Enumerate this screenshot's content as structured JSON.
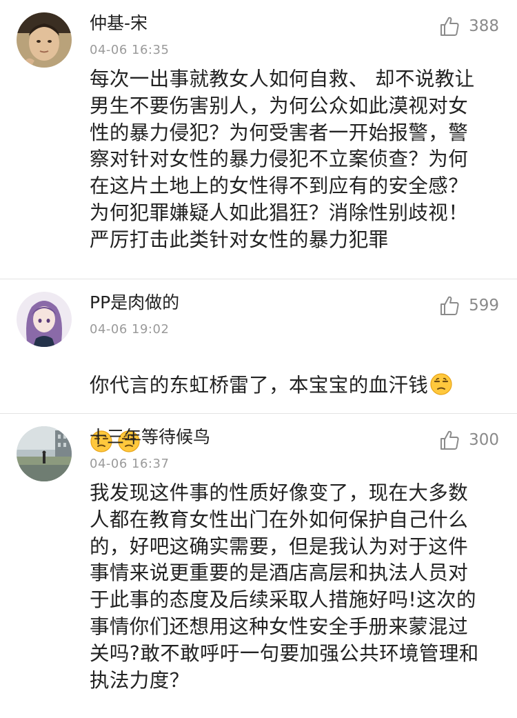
{
  "comments": [
    {
      "username": "仲基-宋",
      "timestamp": "04-06 16:35",
      "likes": "388",
      "avatar_icon": "avatar-photo-man",
      "content": "每次一出事就教女人如何自救、 却不说教让\n男生不要伤害别人，为何公众如此漠视对女\n性的暴力侵犯？为何受害者一开始报警，警\n察对针对女性的暴力侵犯不立案侦查？为何\n在这片土地上的女性得不到应有的安全感？\n为何犯罪嫌疑人如此猖狂？消除性别歧视！\n严厉打击此类针对女性的暴力犯罪"
    },
    {
      "username": "PP是肉做的",
      "timestamp": "04-06 19:02",
      "likes": "599",
      "avatar_icon": "avatar-anime-girl",
      "content": "你代言的东虹桥雷了，本宝宝的血汗钱",
      "emojis": [
        "unamused-face-emoji",
        "unamused-face-emoji",
        "unamused-face-emoji"
      ]
    },
    {
      "username": "十三年等待候鸟",
      "timestamp": "04-06 16:37",
      "likes": "300",
      "avatar_icon": "avatar-street-scene",
      "content": "我发现这件事的性质好像变了，现在大多数\n人都在教育女性出门在外如何保护自己什么\n的，好吧这确实需要，但是我认为对于这件\n事情来说更重要的是酒店高层和执法人员对\n于此事的态度及后续采取人措施好吗!这次的\n事情你们还想用这种女性安全手册来蒙混过\n关吗?敢不敢呼吁一句要加强公共环境管理和\n执法力度？"
    }
  ],
  "icons": {
    "like": "thumbs-up-icon"
  },
  "colors": {
    "username": "#222222",
    "timestamp": "#9a9a9a",
    "likes": "#8a8a8a",
    "divider": "#e3e3e3"
  }
}
